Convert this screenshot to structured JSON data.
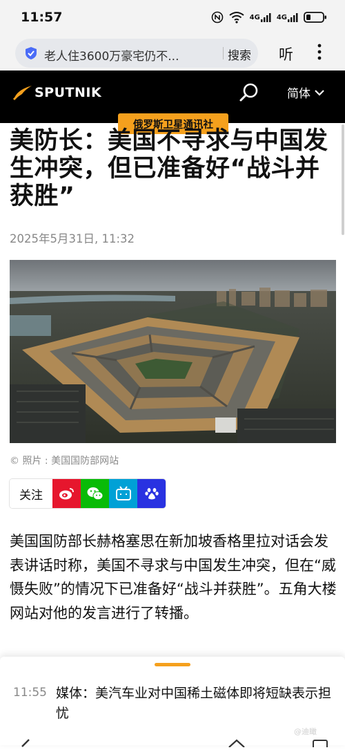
{
  "status_bar": {
    "time": "11:57",
    "net1": "4G",
    "net2": "4G"
  },
  "browser": {
    "url_text": "老人住3600万豪宅仍不...",
    "search_label": "搜索",
    "listen_label": "听"
  },
  "header": {
    "logo_text": "SPUTNIK",
    "language": "简体"
  },
  "badge": "俄罗斯卫星通讯社",
  "article": {
    "title": "美防长：美国不寻求与中国发生冲突，但已准备好“战斗并获胜”",
    "date": "2025年5月31日, 11:32",
    "photo_caption": "© 照片 : 美国国防部网站",
    "body": "美国国防部长赫格塞思在新加坡香格里拉对话会发表讲话时称，美国不寻求与中国发生冲突，但在“威慑失败”的情况下已准备好“战斗并获胜”。五角大楼网站对他的发言进行了转播。"
  },
  "share": {
    "follow_label": "关注",
    "colors": {
      "weibo": "#e6162d",
      "wechat": "#09bb07",
      "bilibili": "#00a1d6",
      "baidu": "#2932e1"
    }
  },
  "next_article": {
    "time": "11:55",
    "title": "媒体：美汽车业对中国稀土磁体即将短缺表示担忧"
  },
  "watermark": "@迪瞰",
  "colors": {
    "accent": "#f5a01d",
    "header_bg": "#000000"
  }
}
